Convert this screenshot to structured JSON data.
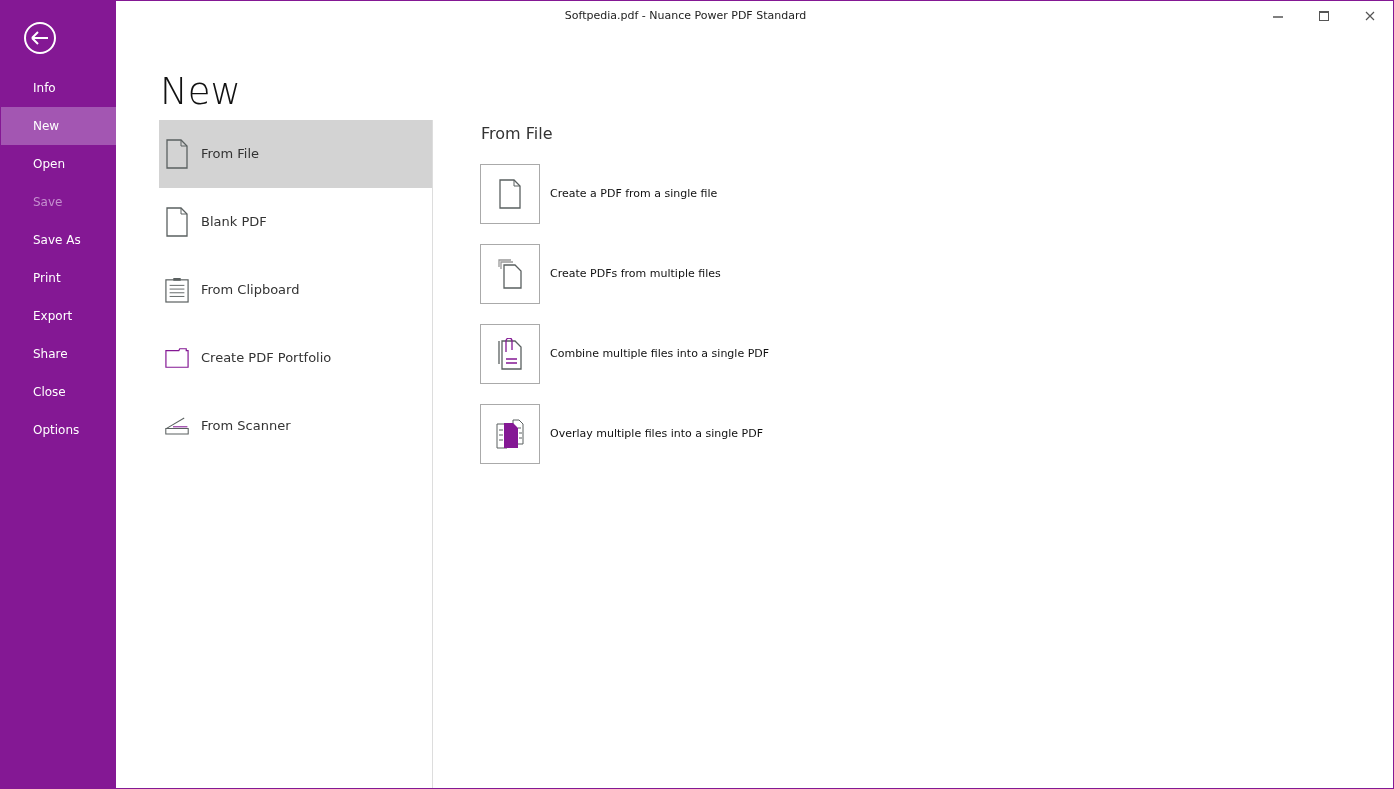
{
  "window": {
    "title": "Softpedia.pdf - Nuance Power PDF Standard"
  },
  "sidebar": {
    "items": [
      {
        "label": "Info",
        "selected": false,
        "disabled": false
      },
      {
        "label": "New",
        "selected": true,
        "disabled": false
      },
      {
        "label": "Open",
        "selected": false,
        "disabled": false
      },
      {
        "label": "Save",
        "selected": false,
        "disabled": true
      },
      {
        "label": "Save As",
        "selected": false,
        "disabled": false
      },
      {
        "label": "Print",
        "selected": false,
        "disabled": false
      },
      {
        "label": "Export",
        "selected": false,
        "disabled": false
      },
      {
        "label": "Share",
        "selected": false,
        "disabled": false
      },
      {
        "label": "Close",
        "selected": false,
        "disabled": false
      },
      {
        "label": "Options",
        "selected": false,
        "disabled": false
      }
    ]
  },
  "page": {
    "title": "New"
  },
  "sources": [
    {
      "label": "From File",
      "kind": "file",
      "selected": true
    },
    {
      "label": "Blank PDF",
      "kind": "file",
      "selected": false
    },
    {
      "label": "From Clipboard",
      "kind": "clipboard",
      "selected": false
    },
    {
      "label": "Create PDF Portfolio",
      "kind": "folder",
      "selected": false
    },
    {
      "label": "From Scanner",
      "kind": "scanner",
      "selected": false
    }
  ],
  "detail": {
    "title": "From File",
    "actions": [
      {
        "label": "Create a PDF from a single file",
        "kind": "single"
      },
      {
        "label": "Create PDFs from multiple files",
        "kind": "multiple"
      },
      {
        "label": "Combine multiple files into a single PDF",
        "kind": "combine"
      },
      {
        "label": "Overlay multiple files into a single PDF",
        "kind": "overlay"
      }
    ]
  }
}
